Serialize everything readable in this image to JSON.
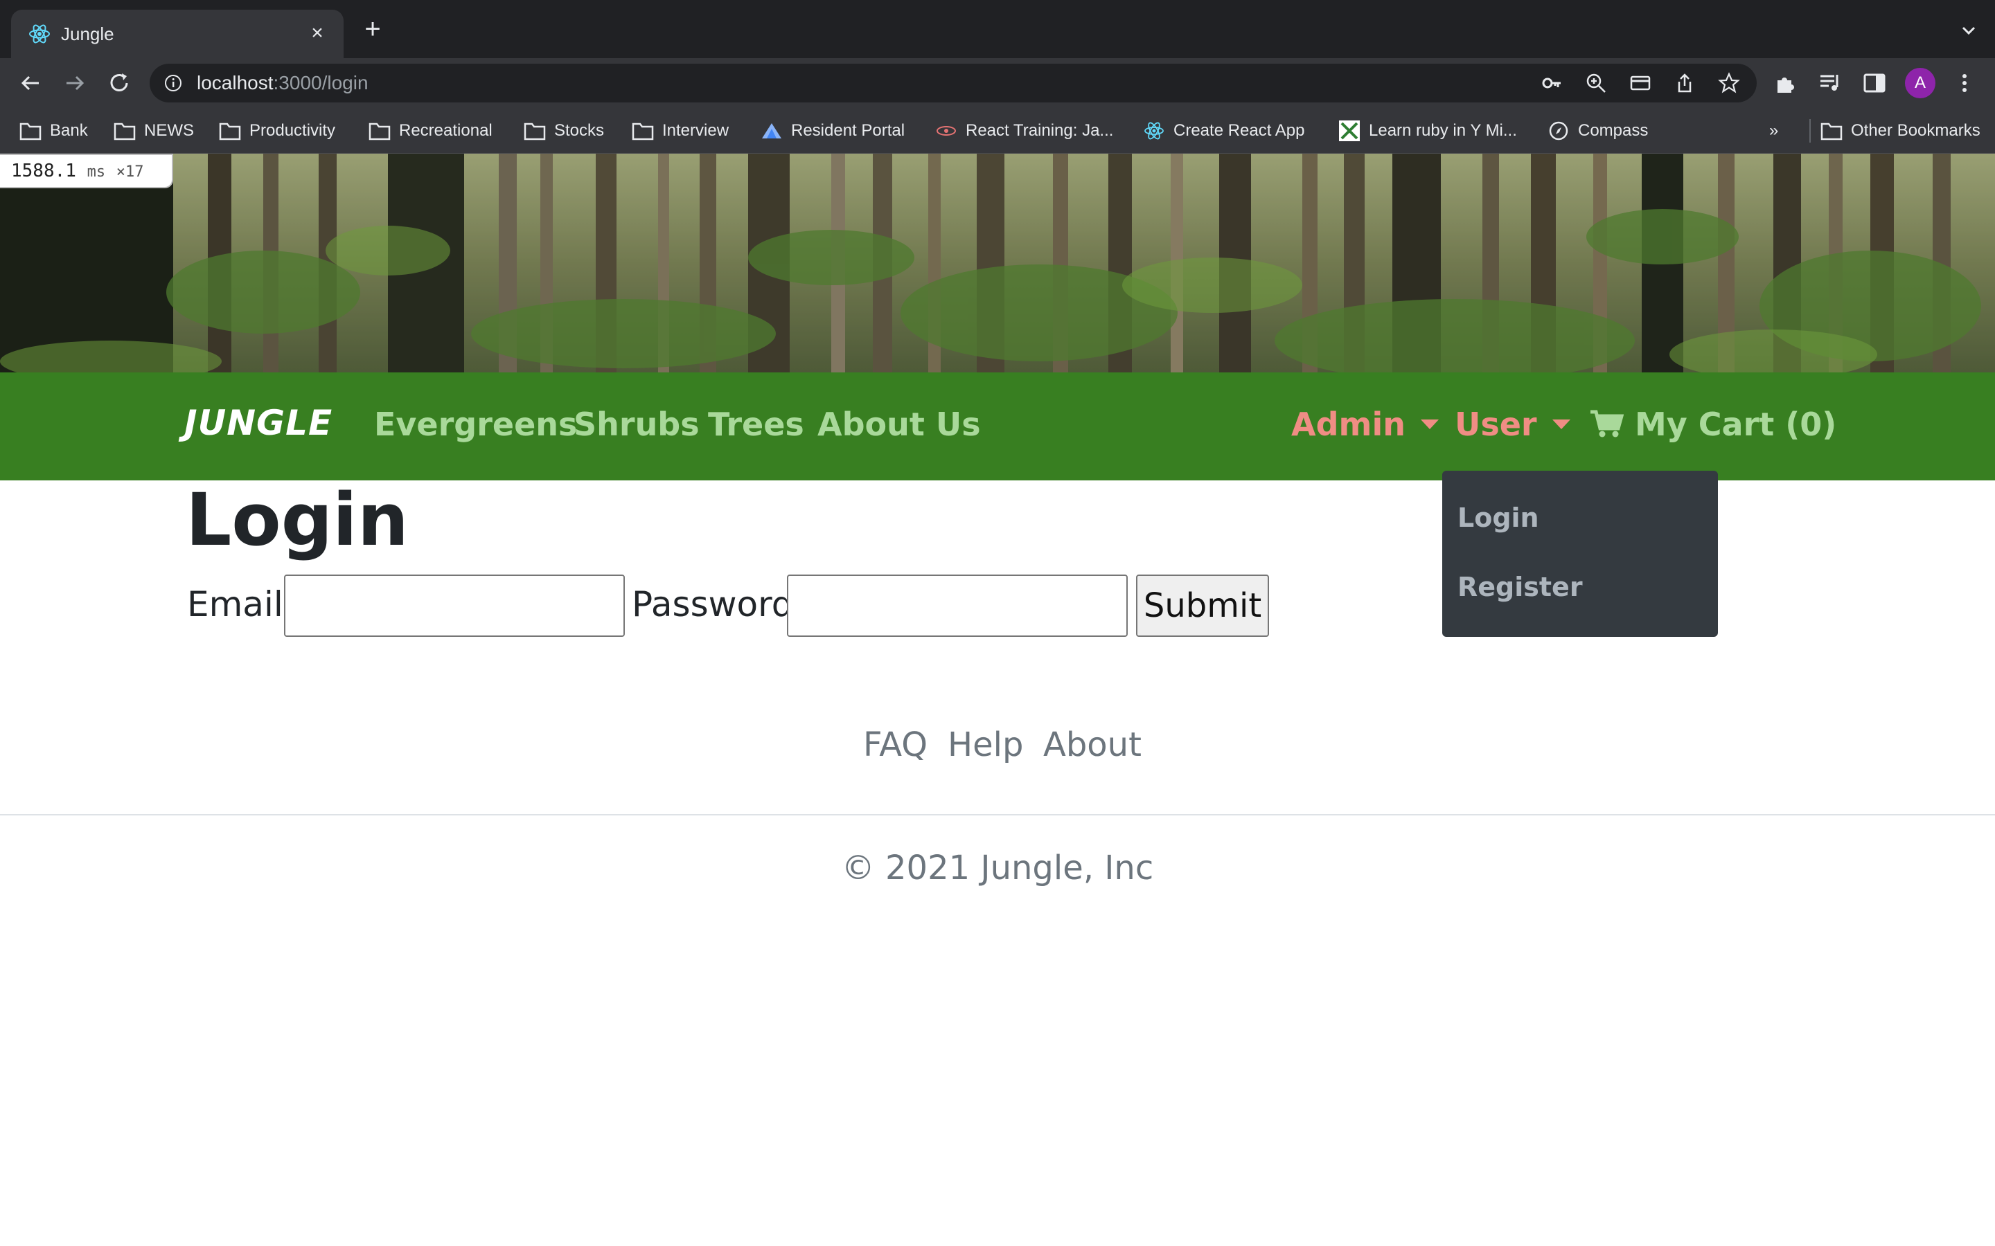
{
  "browser": {
    "tab_title": "Jungle",
    "close_glyph": "×",
    "new_tab_glyph": "+",
    "url_host": "localhost",
    "url_path": ":3000/login",
    "avatar_letter": "A",
    "bookmarks": [
      {
        "label": "Bank",
        "icon": "folder-icon"
      },
      {
        "label": "NEWS",
        "icon": "folder-icon"
      },
      {
        "label": "Productivity",
        "icon": "folder-icon"
      },
      {
        "label": "Recreational",
        "icon": "folder-icon"
      },
      {
        "label": "Stocks",
        "icon": "folder-icon"
      },
      {
        "label": "Interview",
        "icon": "folder-icon"
      },
      {
        "label": "Resident Portal",
        "icon": "portal-icon"
      },
      {
        "label": "React Training: Ja...",
        "icon": "react-training-icon"
      },
      {
        "label": "Create React App",
        "icon": "react-icon"
      },
      {
        "label": "Learn ruby in Y Mi...",
        "icon": "x-icon"
      },
      {
        "label": "Compass",
        "icon": "compass-icon"
      }
    ],
    "overflow_glyph": "»",
    "other_bookmarks": "Other Bookmarks"
  },
  "perf": {
    "value": "1588.1",
    "unit": "ms",
    "count": "×17"
  },
  "nav": {
    "brand": "JUNGLE",
    "links": [
      "Evergreens",
      "Shrubs",
      "Trees",
      "About Us"
    ],
    "admin": "Admin",
    "user": "User",
    "cart": "My Cart (0)"
  },
  "user_menu": {
    "items": [
      "Login",
      "Register"
    ]
  },
  "main": {
    "title": "Login",
    "email_label": "Email:",
    "email_value": "",
    "password_label": "Password:",
    "password_value": "",
    "submit_label": "Submit"
  },
  "footer": {
    "links": [
      "FAQ",
      "Help",
      "About"
    ],
    "copyright": "© 2021 Jungle, Inc"
  },
  "colors": {
    "nav_bg": "#387f21",
    "nav_link": "#a9d99a",
    "nav_accent": "#f08d84",
    "dropdown_bg": "#343a40"
  }
}
